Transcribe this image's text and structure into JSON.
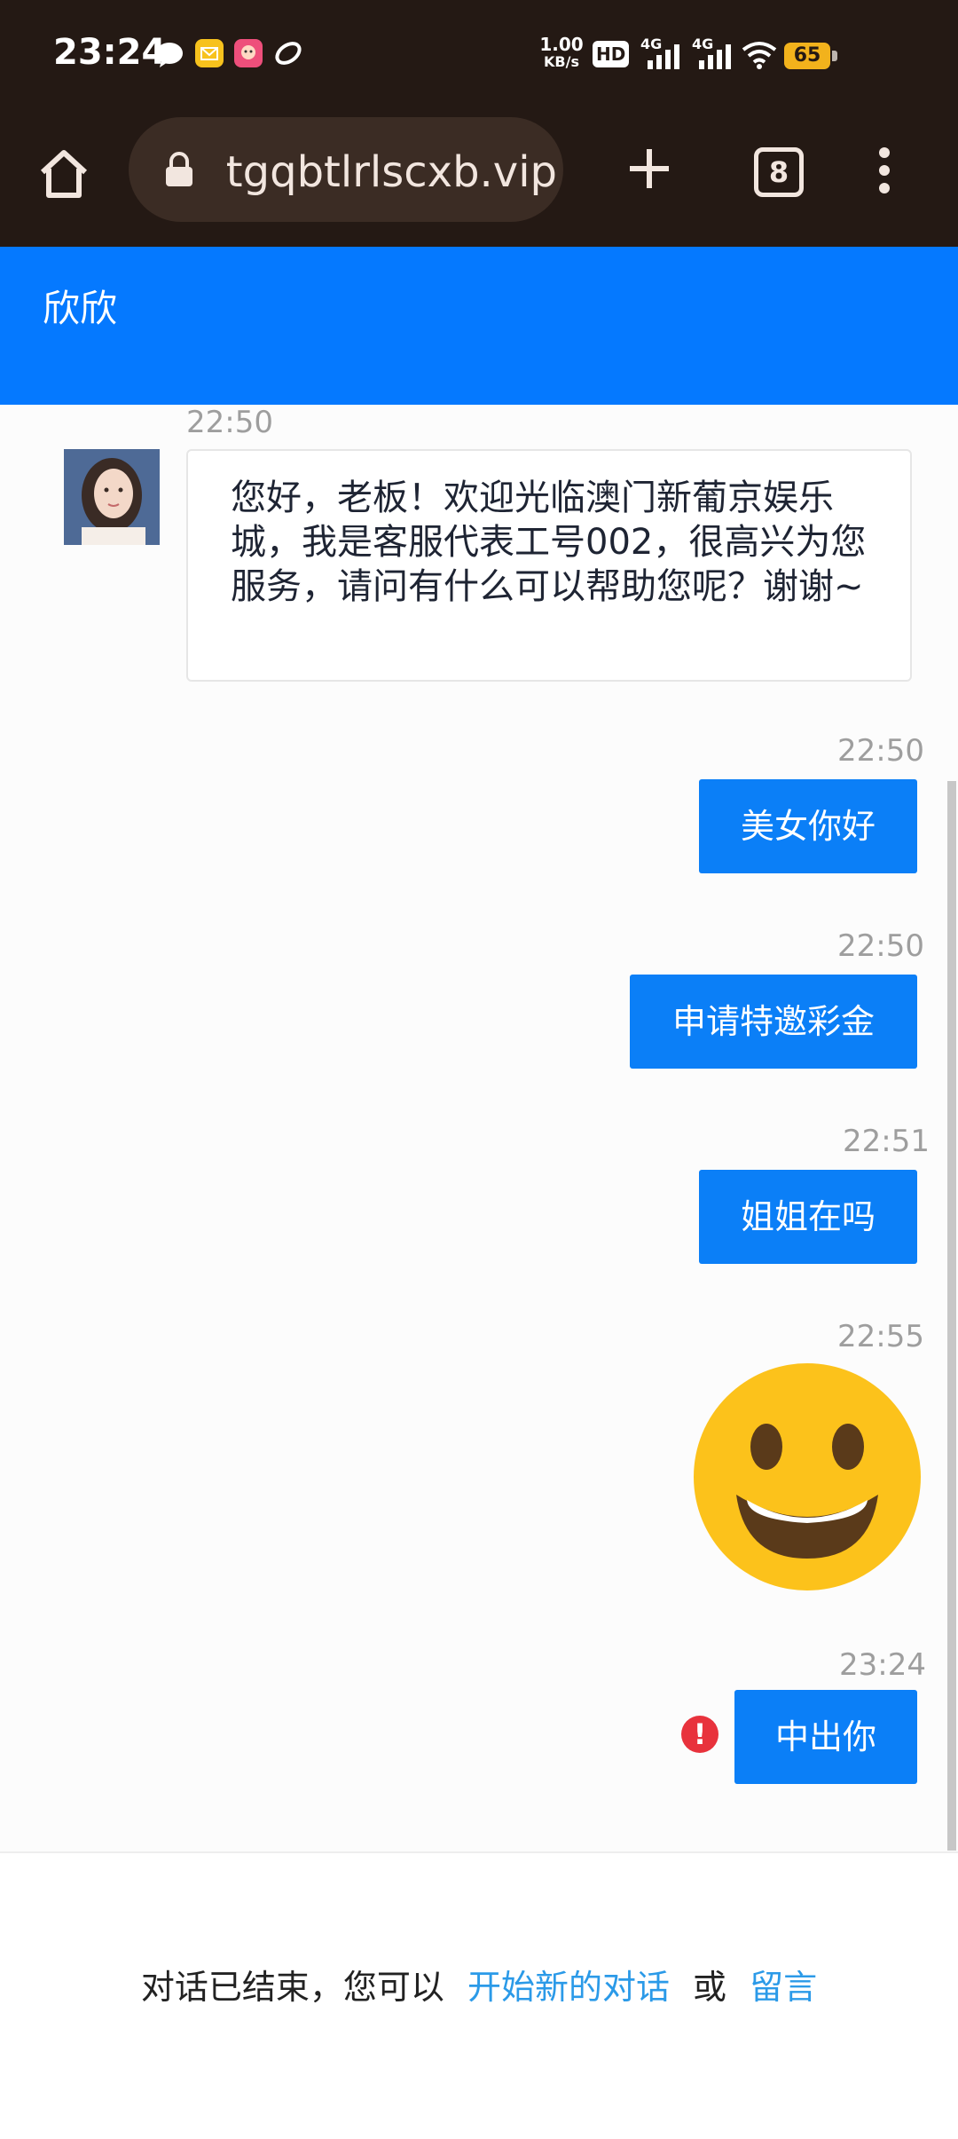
{
  "status_bar": {
    "time": "23:24",
    "network_speed_value": "1.00",
    "network_speed_unit": "KB/s",
    "hd_label": "HD",
    "network_1": "4G",
    "network_2": "4G",
    "battery": "65"
  },
  "browser": {
    "url": "ıtgqbtlrlscxb.vip",
    "tab_count": "8"
  },
  "chat": {
    "agent_name": "欣欣",
    "messages": [
      {
        "side": "in",
        "time": "22:50",
        "text": "您好，老板！欢迎光临澳门新葡京娱乐城，我是客服代表工号002，很高兴为您服务，请问有什么可以帮助您呢？谢谢~"
      },
      {
        "side": "out",
        "time": "22:50",
        "text": "美女你好"
      },
      {
        "side": "out",
        "time": "22:50",
        "text": "申请特邀彩金"
      },
      {
        "side": "out",
        "time": "22:51",
        "text": "姐姐在吗"
      },
      {
        "side": "out",
        "time": "22:55",
        "emoji": "grinning-face"
      },
      {
        "side": "out",
        "time": "23:24",
        "text": "中出你",
        "status": "failed"
      }
    ]
  },
  "footer": {
    "prefix": "对话已结束，您可以",
    "new_chat_link": "开始新的对话",
    "or": "或",
    "leave_message_link": "留言"
  },
  "colors": {
    "header": "#0579ff",
    "bubble_out": "#0b7ff7",
    "browser_bar": "#241914",
    "link": "#2b9ae8",
    "error": "#e8323c"
  }
}
